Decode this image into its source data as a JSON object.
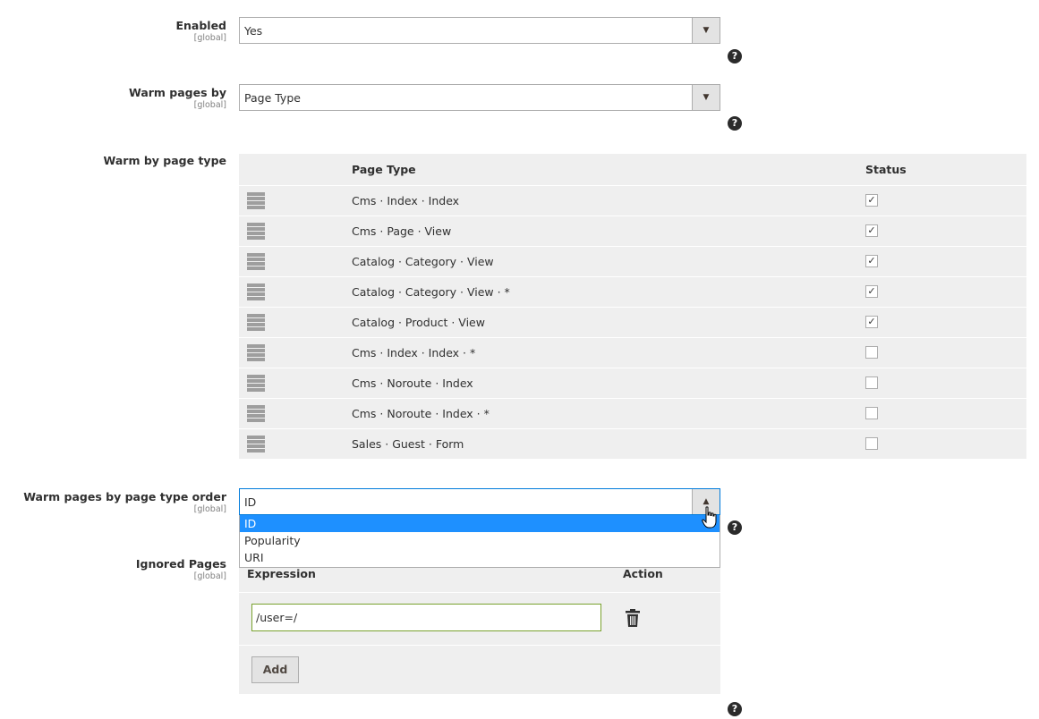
{
  "enabled": {
    "label": "Enabled",
    "scope": "[global]",
    "value": "Yes"
  },
  "warm_pages_by": {
    "label": "Warm pages by",
    "scope": "[global]",
    "value": "Page Type"
  },
  "warm_by_page_type": {
    "label": "Warm by page type",
    "columns": {
      "page_type": "Page Type",
      "status": "Status"
    },
    "rows": [
      {
        "label": "Cms · Index · Index",
        "checked": true
      },
      {
        "label": "Cms · Page · View",
        "checked": true
      },
      {
        "label": "Catalog · Category · View",
        "checked": true
      },
      {
        "label": "Catalog · Category · View · *",
        "checked": true
      },
      {
        "label": "Catalog · Product · View",
        "checked": true
      },
      {
        "label": "Cms · Index · Index · *",
        "checked": false
      },
      {
        "label": "Cms · Noroute · Index",
        "checked": false
      },
      {
        "label": "Cms · Noroute · Index · *",
        "checked": false
      },
      {
        "label": "Sales · Guest · Form",
        "checked": false
      }
    ]
  },
  "order": {
    "label": "Warm pages by page type order",
    "scope": "[global]",
    "value": "ID",
    "options": [
      "ID",
      "Popularity",
      "URI"
    ],
    "selected_index": 0
  },
  "ignored_pages": {
    "label": "Ignored Pages",
    "scope": "[global]",
    "columns": {
      "expression": "Expression",
      "action": "Action"
    },
    "rows": [
      {
        "expression": "/user=/"
      }
    ],
    "add_label": "Add"
  },
  "help_glyph": "?",
  "colors": {
    "accent": "#1e90ff",
    "focus_border": "#007bdb",
    "valid_border": "#79a22e"
  }
}
